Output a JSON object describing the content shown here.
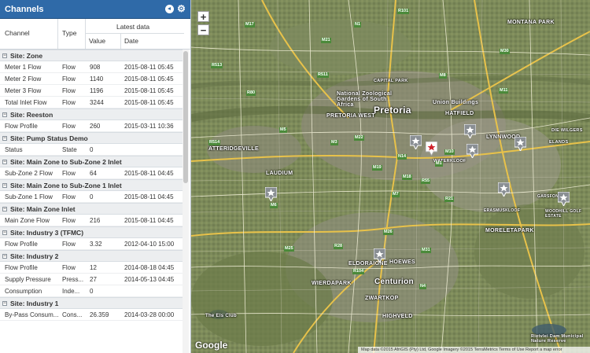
{
  "panel": {
    "title": "Channels",
    "columns": {
      "channel": "Channel",
      "type": "Type",
      "latest": "Latest data",
      "value": "Value",
      "date": "Date"
    }
  },
  "groups": [
    {
      "label": "Site: Zone",
      "rows": [
        {
          "name": "Meter 1 Flow",
          "type": "Flow",
          "value": "908",
          "date": "2015-08-11 05:45"
        },
        {
          "name": "Meter 2 Flow",
          "type": "Flow",
          "value": "1140",
          "date": "2015-08-11 05:45"
        },
        {
          "name": "Meter 3 Flow",
          "type": "Flow",
          "value": "1196",
          "date": "2015-08-11 05:45"
        },
        {
          "name": "Total Inlet Flow",
          "type": "Flow",
          "value": "3244",
          "date": "2015-08-11 05:45"
        }
      ]
    },
    {
      "label": "Site: Reeston",
      "rows": [
        {
          "name": "Flow Profile",
          "type": "Flow",
          "value": "260",
          "date": "2015-03-11 10:36"
        }
      ]
    },
    {
      "label": "Site: Pump Status Demo",
      "rows": [
        {
          "name": "Status",
          "type": "State",
          "value": "0",
          "date": ""
        }
      ]
    },
    {
      "label": "Site: Main Zone to Sub-Zone 2 Inlet",
      "rows": [
        {
          "name": "Sub-Zone 2 Flow",
          "type": "Flow",
          "value": "64",
          "date": "2015-08-11 04:45"
        }
      ]
    },
    {
      "label": "Site: Main Zone to Sub-Zone 1 Inlet",
      "rows": [
        {
          "name": "Sub-Zone 1 Flow",
          "type": "Flow",
          "value": "0",
          "date": "2015-08-11 04:45"
        }
      ]
    },
    {
      "label": "Site: Main Zone Inlet",
      "rows": [
        {
          "name": "Main Zone Flow",
          "type": "Flow",
          "value": "216",
          "date": "2015-08-11 04:45"
        }
      ]
    },
    {
      "label": "Site: Industry 3 (TFMC)",
      "rows": [
        {
          "name": "Flow Profile",
          "type": "Flow",
          "value": "3.32",
          "date": "2012-04-10 15:00"
        }
      ]
    },
    {
      "label": "Site: Industry 2",
      "rows": [
        {
          "name": "Flow Profile",
          "type": "Flow",
          "value": "12",
          "date": "2014-08-18 04:45"
        },
        {
          "name": "Supply Pressure",
          "type": "Press...",
          "value": "27",
          "date": "2014-05-13 04:45"
        },
        {
          "name": "Consumption",
          "type": "Inde...",
          "value": "0",
          "date": ""
        }
      ]
    },
    {
      "label": "Site: Industry 1",
      "rows": [
        {
          "name": "By-Pass Consum...",
          "type": "Cons...",
          "value": "26.359",
          "date": "2014-03-28 00:00"
        }
      ]
    }
  ],
  "map": {
    "zoom_in": "+",
    "zoom_out": "−",
    "google": "Google",
    "footer": "Map data ©2015 AfriGIS (Pty) Ltd, Google Imagery ©2015 TerraMetrics   Terms of Use   Report a map error",
    "places": {
      "pretoria": "Pretoria",
      "pretoria_west": "PRETORIA WEST",
      "hatfield": "HATFIELD",
      "lynnwood": "LYNNWOOD",
      "atteridgeville": "ATTERIDGEVILLE",
      "laudium": "LAUDIUM",
      "moreletapark": "MORELETAPARK",
      "eldoraigne": "ELDORAIGNE",
      "centurion": "Centurion",
      "wierdapark": "WIERDAPARK",
      "zwartkop": "ZWARTKOP",
      "highveld": "HIGHVELD",
      "hoewes": "HOEWES",
      "montana_park": "MONTANA PARK",
      "union_buildings": "Union Buildings",
      "national_zoo": "National Zoological Gardens of South Africa",
      "capital_park": "CAPITAL PARK",
      "waterkloof": "WATERKLOOF",
      "die_wilgers": "DIE WILGERS",
      "elands": "ELANDS",
      "the_els_club": "The Els Club",
      "rietvlei": "Rietvlei Dam Municipal Nature Reserve",
      "woodhill": "WOODHILL GOLF ESTATE",
      "erasmuskloof": "ERASMUSKLOOF",
      "garsfontein": "GARSFONTEIN"
    },
    "roads": [
      "M17",
      "M21",
      "N1",
      "R101",
      "R513",
      "R80",
      "R511",
      "M22",
      "M8",
      "M3",
      "M5",
      "N14",
      "R55",
      "M18",
      "M7",
      "R21",
      "M10",
      "R28",
      "M26",
      "M25",
      "R104",
      "M11",
      "M30",
      "M31",
      "N4",
      "M1",
      "M19",
      "R514",
      "M6"
    ]
  },
  "colors": {
    "header": "#2f6aa8",
    "marker_active": "#d0202a",
    "marker": "#8a8f94"
  }
}
